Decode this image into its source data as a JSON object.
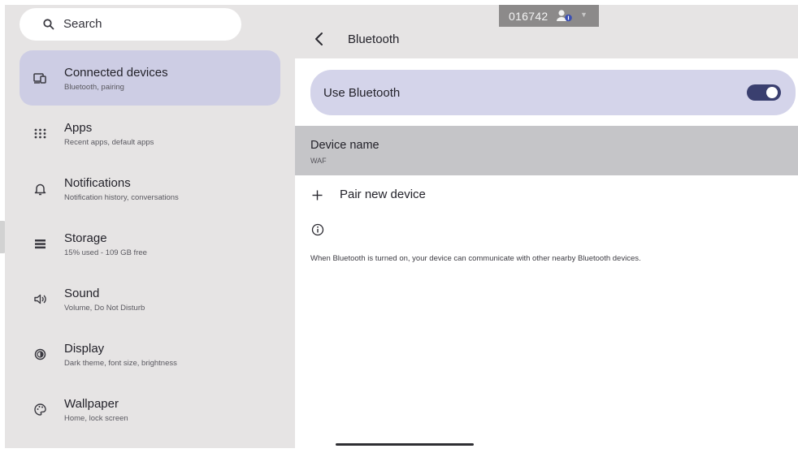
{
  "search": {
    "label": "Search"
  },
  "sidebar": {
    "items": [
      {
        "id": "connected-devices",
        "title": "Connected devices",
        "subtitle": "Bluetooth, pairing",
        "icon": "devices-icon",
        "active": true
      },
      {
        "id": "apps",
        "title": "Apps",
        "subtitle": "Recent apps, default apps",
        "icon": "apps-grid-icon",
        "active": false
      },
      {
        "id": "notifications",
        "title": "Notifications",
        "subtitle": "Notification history, conversations",
        "icon": "bell-icon",
        "active": false
      },
      {
        "id": "storage",
        "title": "Storage",
        "subtitle": "15% used - 109 GB free",
        "icon": "storage-icon",
        "active": false
      },
      {
        "id": "sound",
        "title": "Sound",
        "subtitle": "Volume, Do Not Disturb",
        "icon": "speaker-icon",
        "active": false
      },
      {
        "id": "display",
        "title": "Display",
        "subtitle": "Dark theme, font size, brightness",
        "icon": "brightness-icon",
        "active": false
      },
      {
        "id": "wallpaper",
        "title": "Wallpaper",
        "subtitle": "Home, lock screen",
        "icon": "palette-icon",
        "active": false
      }
    ]
  },
  "header": {
    "title": "Bluetooth"
  },
  "bluetooth": {
    "toggle_label": "Use Bluetooth",
    "toggle_on": true,
    "device_name_title": "Device name",
    "device_name_value": "WAF",
    "pair_label": "Pair new device",
    "info_text": "When Bluetooth is turned on, your device can communicate with other nearby Bluetooth devices."
  },
  "session_badge": {
    "id": "016742"
  },
  "colors": {
    "accent": "#3a3f6f",
    "active_nav": "#cdcde4",
    "toggle_card": "#d4d4ea",
    "pane_bg": "#e6e4e4"
  }
}
